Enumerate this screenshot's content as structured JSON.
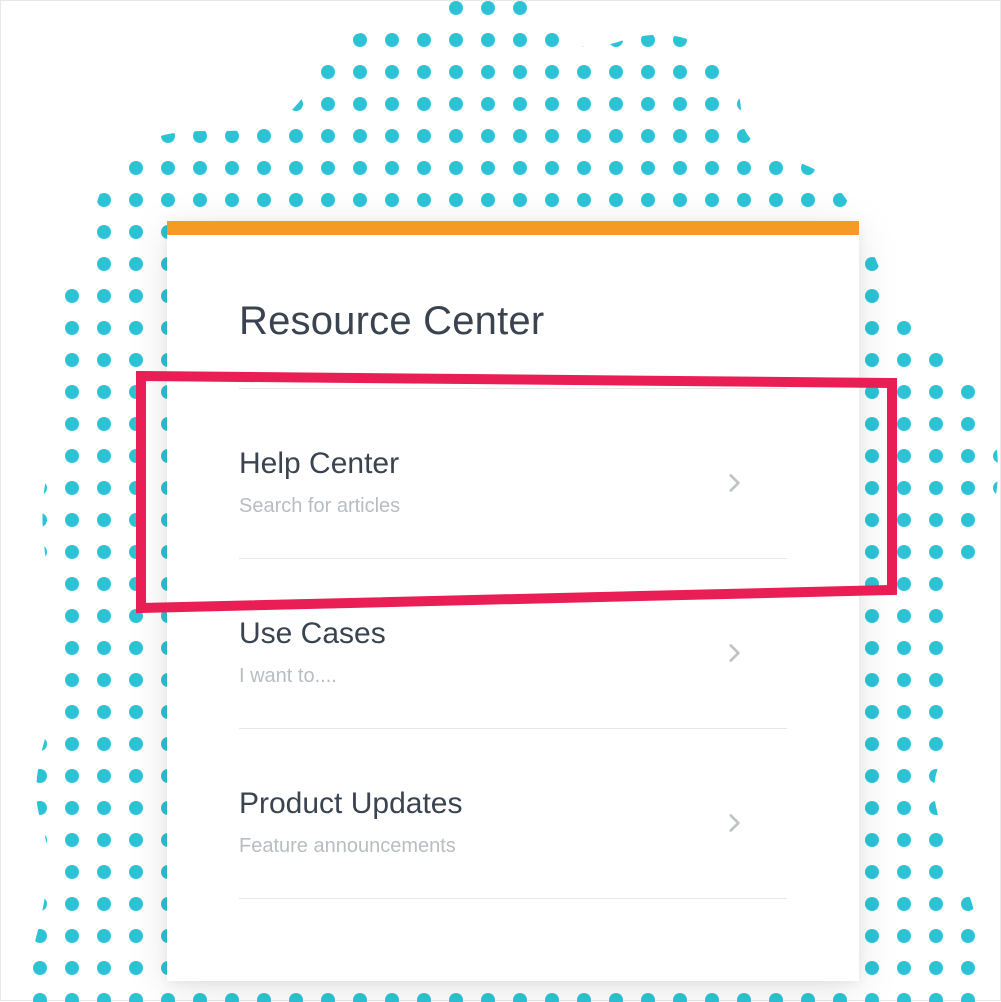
{
  "colors": {
    "accent": "#f59a23",
    "highlight": "#e91e55",
    "dot": "#2cc4d4",
    "title": "#3a4350",
    "subtext": "#b8bdc2"
  },
  "panel": {
    "title": "Resource Center",
    "items": [
      {
        "title": "Help Center",
        "subtitle": "Search for articles"
      },
      {
        "title": "Use Cases",
        "subtitle": "I want to...."
      },
      {
        "title": "Product Updates",
        "subtitle": "Feature announcements"
      }
    ]
  }
}
